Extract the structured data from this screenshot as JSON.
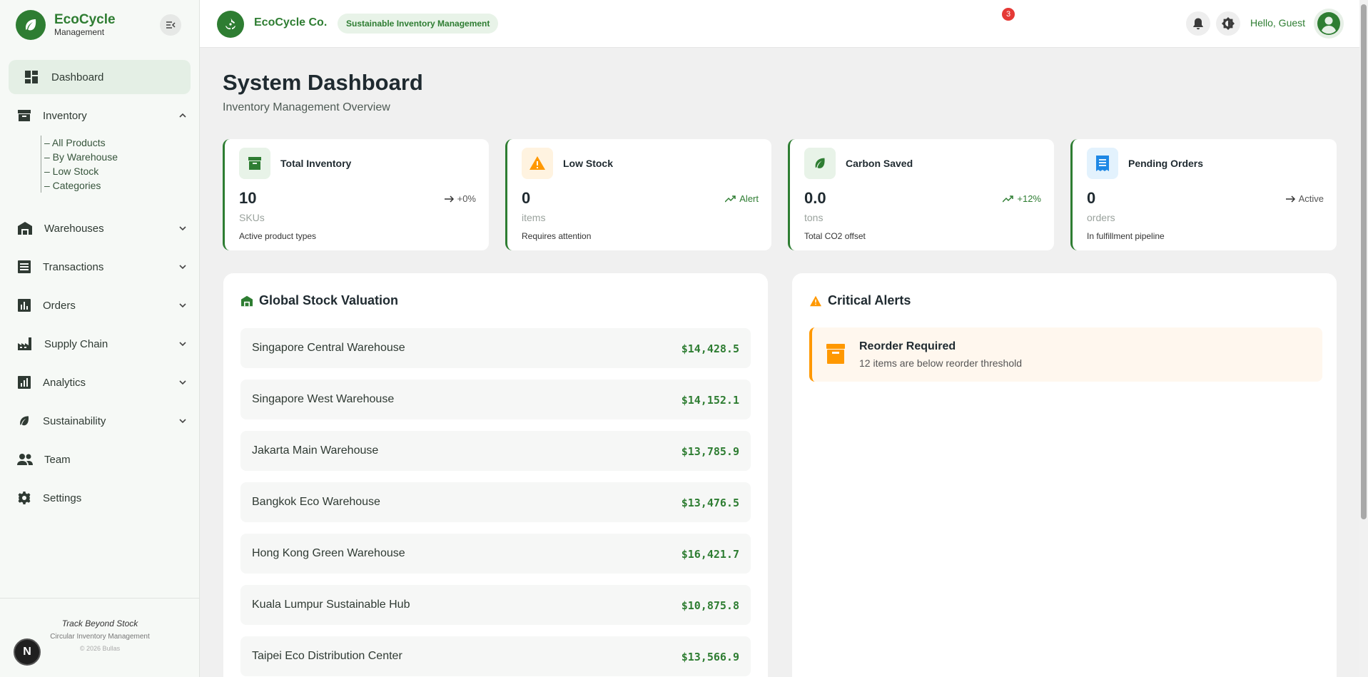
{
  "brand": {
    "title": "EcoCycle",
    "subtitle": "Management"
  },
  "sidebar": {
    "dashboard": "Dashboard",
    "inventory": {
      "label": "Inventory",
      "sub": [
        "– All Products",
        "– By Warehouse",
        "– Low Stock",
        "– Categories"
      ]
    },
    "items": [
      "Warehouses",
      "Transactions",
      "Orders",
      "Supply Chain",
      "Analytics",
      "Sustainability",
      "Team",
      "Settings"
    ],
    "footer": {
      "tagline": "Track Beyond Stock",
      "sub": "Circular Inventory Management",
      "copyright": "© 2026 Bullas"
    },
    "badge": "N"
  },
  "header": {
    "title": "EcoCycle Co.",
    "pill": "Sustainable Inventory Management",
    "notifications": "3",
    "greeting": "Hello, Guest"
  },
  "page": {
    "title": "System Dashboard",
    "subtitle": "Inventory Management Overview"
  },
  "cards": [
    {
      "title": "Total Inventory",
      "value": "10",
      "unit": "SKUs",
      "desc": "Active product types",
      "trend": "+0%"
    },
    {
      "title": "Low Stock",
      "value": "0",
      "unit": "items",
      "desc": "Requires attention",
      "trend": "Alert"
    },
    {
      "title": "Carbon Saved",
      "value": "0.0",
      "unit": "tons",
      "desc": "Total CO2 offset",
      "trend": "+12%"
    },
    {
      "title": "Pending Orders",
      "value": "0",
      "unit": "orders",
      "desc": "In fulfillment pipeline",
      "trend": "Active"
    }
  ],
  "valuation": {
    "title": "Global Stock Valuation",
    "rows": [
      {
        "name": "Singapore Central Warehouse",
        "value": "$14,428.5"
      },
      {
        "name": "Singapore West Warehouse",
        "value": "$14,152.1"
      },
      {
        "name": "Jakarta Main Warehouse",
        "value": "$13,785.9"
      },
      {
        "name": "Bangkok Eco Warehouse",
        "value": "$13,476.5"
      },
      {
        "name": "Hong Kong Green Warehouse",
        "value": "$16,421.7"
      },
      {
        "name": "Kuala Lumpur Sustainable Hub",
        "value": "$10,875.8"
      },
      {
        "name": "Taipei Eco Distribution Center",
        "value": "$13,566.9"
      }
    ]
  },
  "alerts": {
    "title": "Critical Alerts",
    "items": [
      {
        "title": "Reorder Required",
        "text": "12 items are below reorder threshold"
      }
    ]
  },
  "colors": {
    "accent": "#2e7d32",
    "warning": "#ff9800",
    "danger": "#e53935",
    "info": "#1e88e5"
  }
}
